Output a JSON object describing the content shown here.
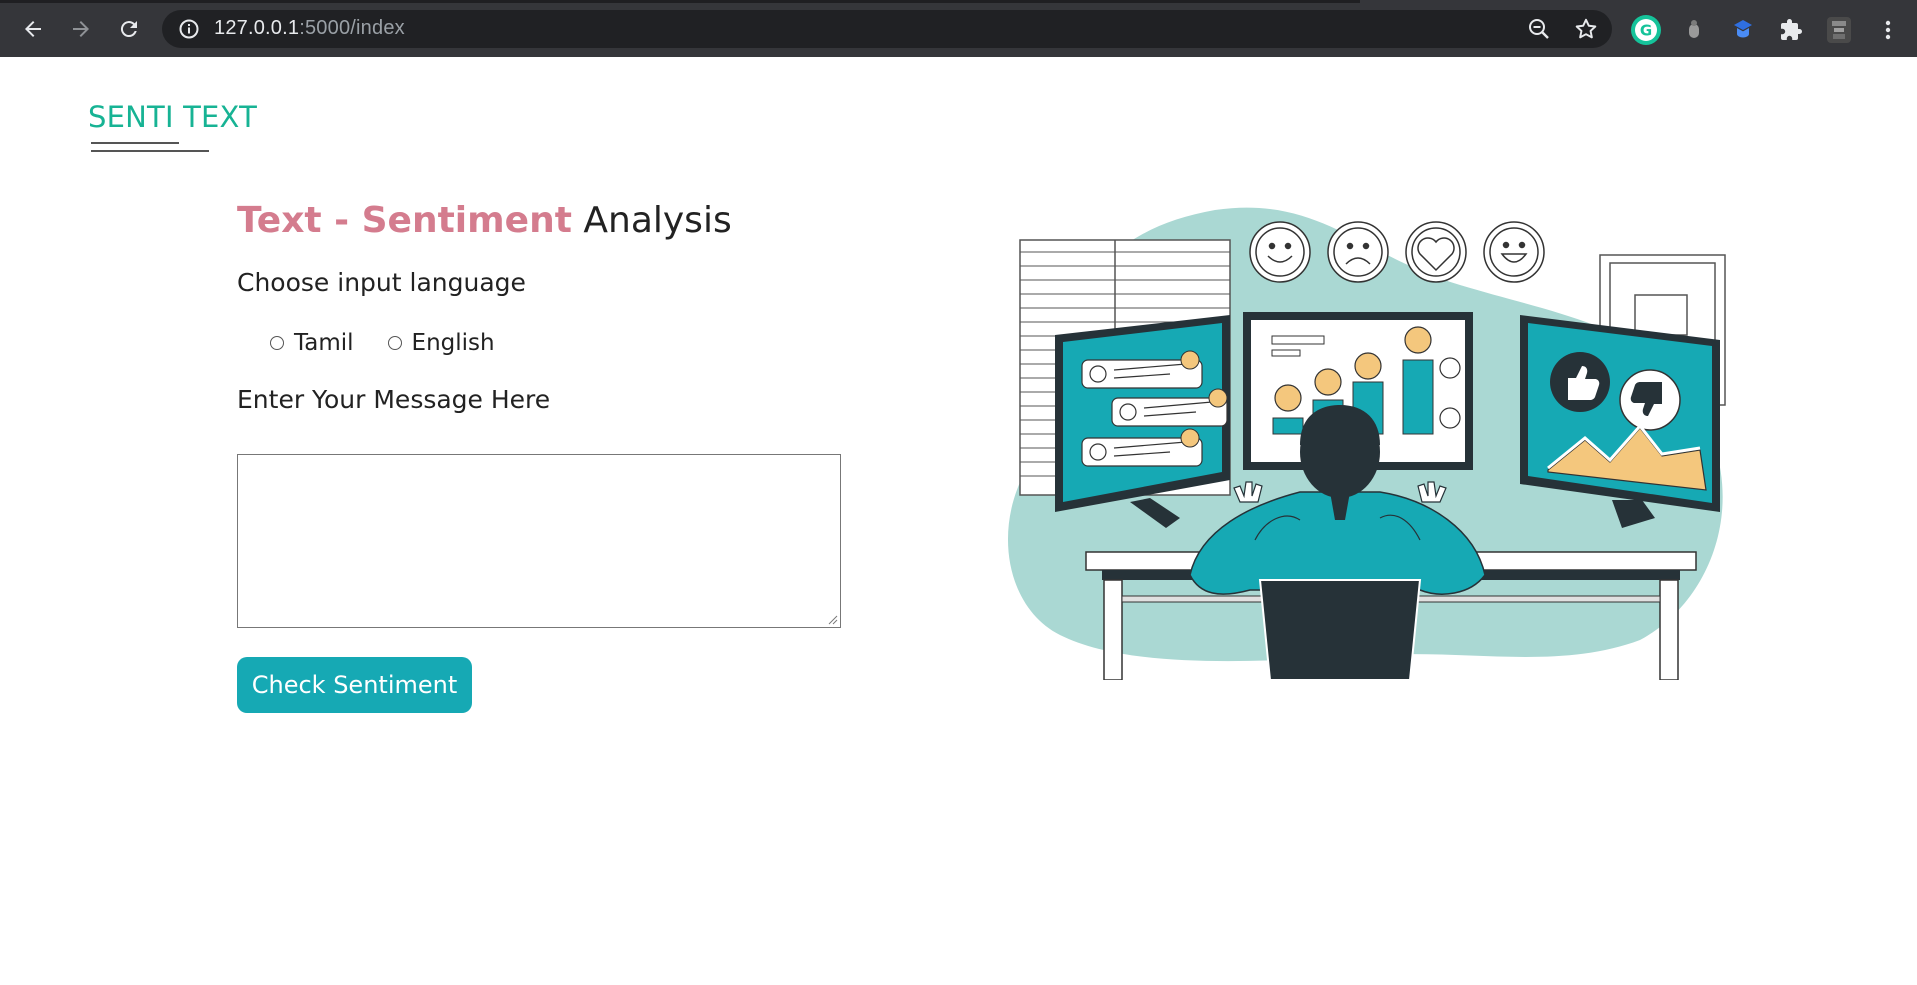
{
  "browser": {
    "url_host": "127.0.0.1",
    "url_path": ":5000/index",
    "icons": [
      "back-icon",
      "forward-icon",
      "reload-icon",
      "info-icon",
      "zoom-out-icon",
      "star-icon",
      "grammarly-icon",
      "extension-icon",
      "extension-blue-icon",
      "puzzle-icon",
      "profile-avatar",
      "menu-icon"
    ]
  },
  "logo": {
    "text": "SENTI TEXT",
    "color": "#17b394"
  },
  "headline": {
    "accent": "Text - Sentiment",
    "rest": "Analysis",
    "accent_color": "#d47c8e"
  },
  "language": {
    "label": "Choose input language",
    "options": [
      "Tamil",
      "English"
    ]
  },
  "message": {
    "label": "Enter Your Message Here",
    "value": ""
  },
  "submit": {
    "label": "Check Sentiment",
    "color": "#16a9b4"
  },
  "illustration": {
    "description_icons": [
      "smile-emoji-icon",
      "sad-emoji-icon",
      "heart-icon",
      "grin-emoji-icon",
      "thumbs-up-icon",
      "thumbs-down-icon"
    ]
  }
}
